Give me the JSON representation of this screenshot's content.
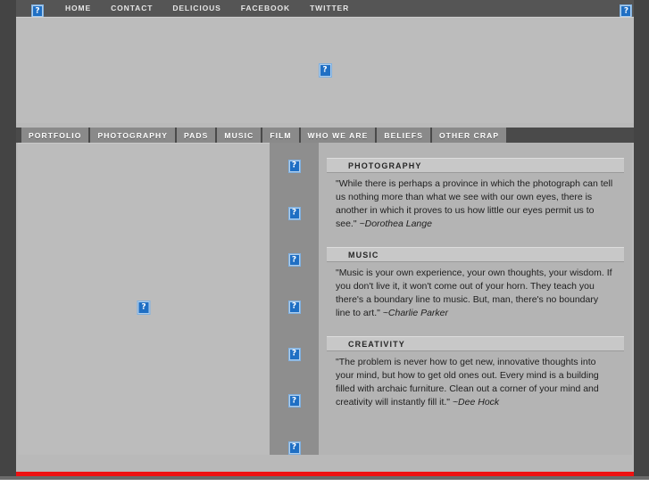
{
  "topbar": {
    "logo_left_icon": "broken-image-icon",
    "logo_right_icon": "broken-image-icon",
    "links": [
      {
        "label": "HOME"
      },
      {
        "label": "CONTACT"
      },
      {
        "label": "DELICIOUS"
      },
      {
        "label": "FACEBOOK"
      },
      {
        "label": "TWITTER"
      }
    ]
  },
  "banner": {
    "image_icon": "broken-image-icon"
  },
  "subnav": {
    "tabs": [
      {
        "label": "PORTFOLIO"
      },
      {
        "label": "PHOTOGRAPHY"
      },
      {
        "label": "PADS"
      },
      {
        "label": "MUSIC"
      },
      {
        "label": "FILM"
      },
      {
        "label": "WHO WE ARE"
      },
      {
        "label": "BELIEFS"
      },
      {
        "label": "OTHER CRAP"
      }
    ]
  },
  "left_column": {
    "image_icon": "broken-image-icon"
  },
  "middle_column": {
    "thumbnails": [
      {
        "icon": "broken-image-icon"
      },
      {
        "icon": "broken-image-icon"
      },
      {
        "icon": "broken-image-icon"
      },
      {
        "icon": "broken-image-icon"
      },
      {
        "icon": "broken-image-icon"
      },
      {
        "icon": "broken-image-icon"
      },
      {
        "icon": "broken-image-icon"
      }
    ]
  },
  "right_column": {
    "quotes": [
      {
        "heading": "PHOTOGRAPHY",
        "text": "\"While there is perhaps a province in which the photograph can tell us nothing more than what we see with our own eyes, there is another in which it proves to us how little our eyes permit us to see.\" ",
        "attribution": "~Dorothea Lange"
      },
      {
        "heading": "MUSIC",
        "text": "\"Music is your own experience, your own thoughts, your wisdom. If you don't live it, it won't come out of your horn. They teach you there's a boundary line to music. But, man, there's no boundary line to art.\" ",
        "attribution": "~Charlie Parker"
      },
      {
        "heading": "CREATIVITY",
        "text": "\"The problem is never how to get new, innovative thoughts into your mind, but how to get old ones out. Every mind is a building filled with archaic furniture. Clean out a corner of your mind and creativity will instantly fill it.\" ",
        "attribution": "~Dee Hock"
      }
    ]
  },
  "colors": {
    "frame": "#444444",
    "topbar": "#555555",
    "subnav_bar": "#4a4a4a",
    "subnav_tab": "#8a8a8a",
    "page_bg": "#b9b9b9",
    "middle_column": "#8e8e8e",
    "quote_head": "#c8c8c8",
    "footer_accent": "#ee1111",
    "placeholder_blue": "#1f6fc4"
  }
}
